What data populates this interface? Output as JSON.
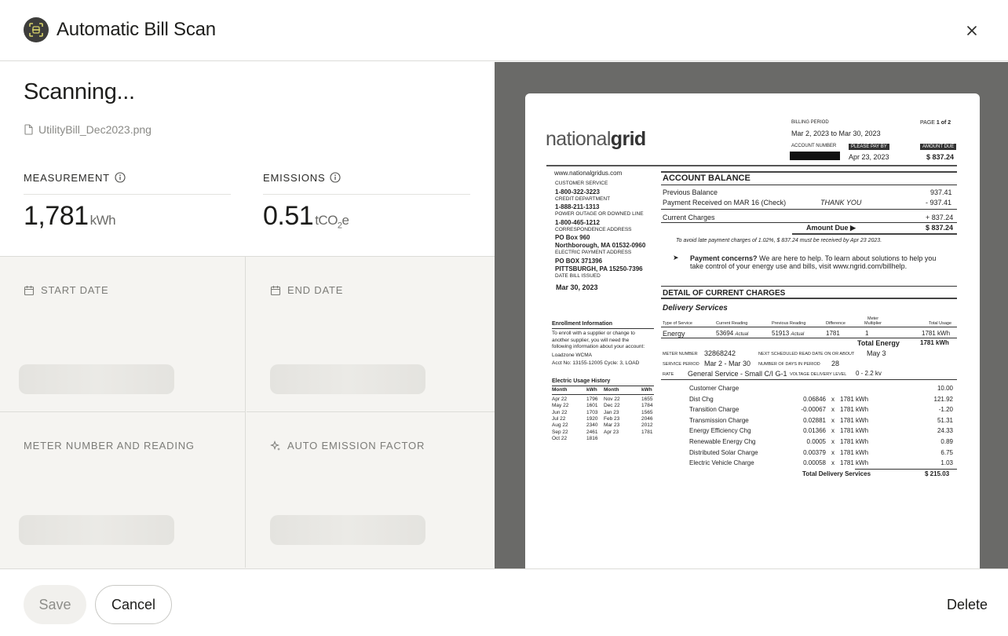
{
  "header": {
    "title": "Automatic Bill Scan"
  },
  "scan": {
    "status": "Scanning...",
    "file_name": "UtilityBill_Dec2023.png"
  },
  "measurement": {
    "label": "MEASUREMENT",
    "value": "1,781",
    "unit": "kWh"
  },
  "emissions": {
    "label": "EMISSIONS",
    "value": "0.51",
    "unit_prefix": "tCO",
    "unit_sub": "2",
    "unit_suffix": "e"
  },
  "fields": {
    "start_date": "START DATE",
    "end_date": "END DATE",
    "meter": "METER NUMBER AND READING",
    "auto_factor": "AUTO EMISSION FACTOR"
  },
  "footer": {
    "save": "Save",
    "cancel": "Cancel",
    "delete": "Delete"
  },
  "bill": {
    "logo_a": "national",
    "logo_b": "grid",
    "billing_period_label": "BILLING PERIOD",
    "billing_period": "Mar 2, 2023  to Mar 30, 2023",
    "page_label": "PAGE",
    "page": "1 of 2",
    "account_number_label": "ACCOUNT NUMBER",
    "please_pay_by_label": "PLEASE PAY BY",
    "pay_by": "Apr 23, 2023",
    "amount_due_label": "AMOUNT DUE",
    "amount_due": "$ 837.24",
    "website": "www.nationalgridus.com",
    "left_col": [
      {
        "t": "CUSTOMER SERVICE",
        "b": false
      },
      {
        "t": "1-800-322-3223",
        "b": true
      },
      {
        "t": "CREDIT DEPARTMENT",
        "b": false
      },
      {
        "t": "1-888-211-1313",
        "b": true
      },
      {
        "t": "POWER OUTAGE OR DOWNED LINE",
        "b": false
      },
      {
        "t": "1-800-465-1212",
        "b": true
      },
      {
        "t": "CORRESPONDENCE ADDRESS",
        "b": false
      },
      {
        "t": "PO Box 960",
        "b": true
      },
      {
        "t": "Northborough, MA 01532-0960",
        "b": true
      },
      {
        "t": "ELECTRIC PAYMENT ADDRESS",
        "b": false
      },
      {
        "t": "PO BOX 371396",
        "b": true
      },
      {
        "t": "PITTSBURGH, PA 15250-7396",
        "b": true
      },
      {
        "t": "DATE BILL ISSUED",
        "b": false
      }
    ],
    "date_issued": "Mar 30, 2023",
    "account_balance_title": "ACCOUNT BALANCE",
    "previous_balance_label": "Previous Balance",
    "previous_balance": "937.41",
    "payment_received_label": "Payment Received on MAR 16 (Check)",
    "thank_you": "THANK YOU",
    "payment_received": "- 937.41",
    "current_charges_label": "Current Charges",
    "current_charges": "+ 837.24",
    "amount_due_row_label": "Amount Due",
    "amount_due_row": "$ 837.24",
    "late_note": "To avoid late payment charges of 1.02%, $ 837.24 must be received by Apr 23 2023.",
    "concerns_bold": "Payment concerns?",
    "concerns_1": "We are here to help.  To learn about solutions to help you",
    "concerns_2": "take control of your energy use and bills, visit www.ngrid.com/billhelp.",
    "detail_title": "DETAIL OF CURRENT CHARGES",
    "delivery_title": "Delivery Services",
    "col_type": "Type of Service",
    "col_current": "Current Reading",
    "col_previous": "Previous Reading",
    "col_diff": "Difference",
    "col_mult_a": "Meter",
    "col_mult_b": "Multiplier",
    "col_total": "Total Usage",
    "energy_label": "Energy",
    "energy_current": "53694",
    "energy_current_tag": "Actual",
    "energy_previous": "51913",
    "energy_previous_tag": "Actual",
    "energy_diff": "1781",
    "energy_mult": "1",
    "energy_total": "1781 kWh",
    "total_energy_label": "Total Energy",
    "total_energy": "1781 kWh",
    "meter_number_label": "METER NUMBER",
    "meter_number": "32868242",
    "next_read_label": "NEXT SCHEDULED READ DATE ON OR ABOUT",
    "next_read": "May 3",
    "service_period_label": "SERVICE PERIOD",
    "service_period": "Mar 2 - Mar 30",
    "days_label": "NUMBER OF DAYS IN PERIOD",
    "days": "28",
    "rate_label": "RATE",
    "rate": "General Service - Small C/I G-1",
    "voltage_label": "VOLTAGE DELIVERY LEVEL",
    "voltage": "0 - 2.2 kv",
    "charges": [
      {
        "name": "Customer Charge",
        "rate": "",
        "x": "",
        "qty": "",
        "amt": "10.00"
      },
      {
        "name": "Dist Chg",
        "rate": "0.06846",
        "x": "x",
        "qty": "1781 kWh",
        "amt": "121.92"
      },
      {
        "name": "Transition Charge",
        "rate": "-0.00067",
        "x": "x",
        "qty": "1781 kWh",
        "amt": "-1.20"
      },
      {
        "name": "Transmission Charge",
        "rate": "0.02881",
        "x": "x",
        "qty": "1781 kWh",
        "amt": "51.31"
      },
      {
        "name": "Energy Efficiency Chg",
        "rate": "0.01366",
        "x": "x",
        "qty": "1781 kWh",
        "amt": "24.33"
      },
      {
        "name": "Renewable Energy Chg",
        "rate": "0.0005",
        "x": "x",
        "qty": "1781 kWh",
        "amt": "0.89"
      },
      {
        "name": "Distributed Solar Charge",
        "rate": "0.00379",
        "x": "x",
        "qty": "1781 kWh",
        "amt": "6.75"
      },
      {
        "name": "Electric Vehicle Charge",
        "rate": "0.00058",
        "x": "x",
        "qty": "1781 kWh",
        "amt": "1.03"
      }
    ],
    "total_delivery_label": "Total Delivery Services",
    "total_delivery": "$ 215.03",
    "enroll_title": "Enrollment Information",
    "enroll_lines": [
      "To enroll with a supplier or change to",
      "another supplier, you will need the",
      "following information about your account:",
      "Loadzone   WCMA",
      "Acct No:   13155-12005   Cycle: 3, LOAD"
    ],
    "history_title": "Electric Usage History",
    "history_head": [
      "Month",
      "kWh",
      "Month",
      "kWh"
    ],
    "history_rows": [
      [
        "Apr 22",
        "1796",
        "Nov 22",
        "1655"
      ],
      [
        "May 22",
        "1601",
        "Dec 22",
        "1784"
      ],
      [
        "Jun 22",
        "1703",
        "Jan 23",
        "1565"
      ],
      [
        "Jul 22",
        "1920",
        "Feb 23",
        "2046"
      ],
      [
        "Aug 22",
        "2340",
        "Mar 23",
        "2012"
      ],
      [
        "Sep 22",
        "2461",
        "Apr 23",
        "1781"
      ],
      [
        "Oct 22",
        "1816",
        "",
        ""
      ]
    ]
  }
}
